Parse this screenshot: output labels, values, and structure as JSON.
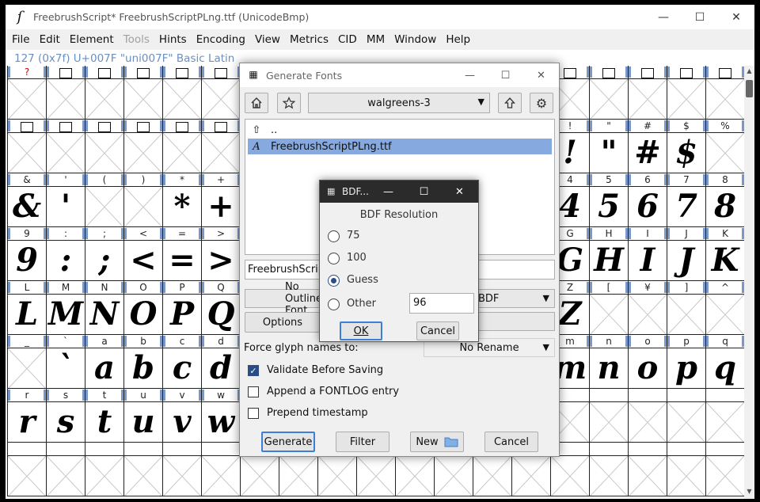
{
  "window": {
    "title": "FreebrushScript*  FreebrushScriptPLng.ttf (UnicodeBmp)",
    "controls": [
      "minimize",
      "maximize",
      "close"
    ]
  },
  "menu": [
    "File",
    "Edit",
    "Element",
    "Tools",
    "Hints",
    "Encoding",
    "View",
    "Metrics",
    "CID",
    "MM",
    "Window",
    "Help"
  ],
  "menu_disabled": [
    "Tools"
  ],
  "info_line": "127 (0x7f) U+007F \"uni007F\" Basic Latin",
  "grid": {
    "rows": [
      {
        "labels": [
          "?",
          "□",
          "□",
          "□",
          "□",
          "□",
          "",
          "",
          "",
          "",
          "",
          "",
          "",
          "",
          "□",
          "□",
          "□",
          "□",
          "□"
        ],
        "glyphs": [
          "",
          "",
          "",
          "",
          "",
          "",
          "",
          "",
          "",
          "",
          "",
          "",
          "",
          "",
          "",
          "",
          "",
          "",
          ""
        ]
      },
      {
        "labels": [
          "□",
          "□",
          "□",
          "□",
          "□",
          "□",
          "",
          "",
          "",
          "",
          "",
          "",
          "",
          "",
          "!",
          "\"",
          "#",
          "$",
          "%"
        ],
        "glyphs": [
          "",
          "",
          "",
          "",
          "",
          "",
          "",
          "",
          "",
          "",
          "",
          "",
          "",
          "",
          "!",
          "\"",
          "#",
          "$",
          ""
        ]
      },
      {
        "labels": [
          "&",
          "'",
          "(",
          ")",
          "*",
          "+",
          "",
          "",
          "",
          "",
          "",
          "",
          "",
          "",
          "4",
          "5",
          "6",
          "7",
          "8"
        ],
        "glyphs": [
          "&",
          "'",
          "",
          "",
          "*",
          "+",
          "",
          "",
          "",
          "",
          "",
          "",
          "",
          "",
          "4",
          "5",
          "6",
          "7",
          "8"
        ]
      },
      {
        "labels": [
          "9",
          ":",
          ";",
          "<",
          "=",
          ">",
          "",
          "",
          "",
          "",
          "",
          "",
          "",
          "",
          "G",
          "H",
          "I",
          "J",
          "K"
        ],
        "glyphs": [
          "9",
          ":",
          ";",
          "<",
          "=",
          ">",
          "",
          "",
          "",
          "",
          "",
          "",
          "",
          "",
          "G",
          "H",
          "I",
          "J",
          "K"
        ]
      },
      {
        "labels": [
          "L",
          "M",
          "N",
          "O",
          "P",
          "Q",
          "",
          "",
          "",
          "",
          "",
          "",
          "",
          "",
          "Z",
          "[",
          "¥",
          "]",
          "^"
        ],
        "glyphs": [
          "L",
          "M",
          "N",
          "O",
          "P",
          "Q",
          "",
          "",
          "",
          "",
          "",
          "",
          "",
          "",
          "Z",
          "",
          "",
          "",
          ""
        ]
      },
      {
        "labels": [
          "_",
          "`",
          "a",
          "b",
          "c",
          "d",
          "",
          "",
          "",
          "",
          "",
          "",
          "",
          "",
          "m",
          "n",
          "o",
          "p",
          "q"
        ],
        "glyphs": [
          "",
          "`",
          "a",
          "b",
          "c",
          "d",
          "",
          "",
          "",
          "",
          "",
          "",
          "",
          "",
          "m",
          "n",
          "o",
          "p",
          "q"
        ]
      },
      {
        "labels": [
          "r",
          "s",
          "t",
          "u",
          "v",
          "w",
          "",
          "",
          "",
          "",
          "",
          "",
          "",
          "",
          "",
          "",
          "",
          "",
          ""
        ],
        "glyphs": [
          "r",
          "s",
          "t",
          "u",
          "v",
          "w",
          "",
          "",
          "",
          "",
          "",
          "",
          "",
          "",
          "",
          "",
          "",
          "",
          ""
        ]
      },
      {
        "labels": [
          "",
          "",
          "",
          "",
          "",
          "",
          "",
          "",
          "",
          "",
          "",
          "",
          "",
          "",
          "",
          "",
          "",
          "",
          ""
        ],
        "glyphs": [
          "",
          "",
          "",
          "",
          "",
          "",
          "",
          "",
          "",
          "",
          "",
          "",
          "",
          "",
          "",
          "",
          "",
          "",
          ""
        ]
      }
    ],
    "missing_label_color": "#d00000",
    "marker_color": "#7a98c7"
  },
  "generate_dialog": {
    "title": "Generate Fonts",
    "home_icon": "home-icon",
    "bookmark_icon": "star-icon",
    "directory": "walgreens-3",
    "up_icon": "up-arrow-icon",
    "settings_icon": "gear-icon",
    "files": [
      {
        "name": "..",
        "icon": "up-arrow-icon",
        "selected": false
      },
      {
        "name": "FreebrushScriptPLng.ttf",
        "icon": "font-file-icon",
        "selected": true
      }
    ],
    "filename": "FreebrushScriptPLng.ttf",
    "outline_format": "No Outline Font",
    "bitmap_format": "BDF",
    "options_label": "Options",
    "force_names_label": "Force glyph names to:",
    "force_names_value": "No Rename",
    "checkboxes": [
      {
        "label": "Validate Before Saving",
        "checked": true
      },
      {
        "label": "Append a FONTLOG entry",
        "checked": false
      },
      {
        "label": "Prepend timestamp",
        "checked": false
      }
    ],
    "buttons": {
      "generate": "Generate",
      "filter": "Filter",
      "new": "New",
      "cancel": "Cancel"
    }
  },
  "bdf_dialog": {
    "title": "BDF...",
    "heading": "BDF Resolution",
    "options": [
      {
        "label": "75",
        "selected": false
      },
      {
        "label": "100",
        "selected": false
      },
      {
        "label": "Guess",
        "selected": true
      },
      {
        "label": "Other",
        "selected": false
      }
    ],
    "other_value": "96",
    "ok": "OK",
    "cancel": "Cancel"
  }
}
